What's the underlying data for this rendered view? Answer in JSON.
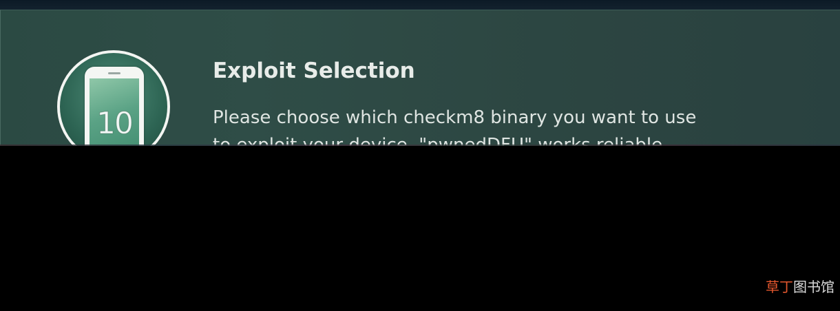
{
  "dialog": {
    "title": "Exploit Selection",
    "body_lines": [
      "Please choose which checkm8 binary you want to use",
      "to exploit your device. \"pwnedDFU\" works reliable"
    ],
    "icon": {
      "name": "ios-10-phone-icon",
      "number": "10"
    }
  },
  "watermark": {
    "part1": "草",
    "part2": "丁",
    "part3": "图书馆"
  }
}
